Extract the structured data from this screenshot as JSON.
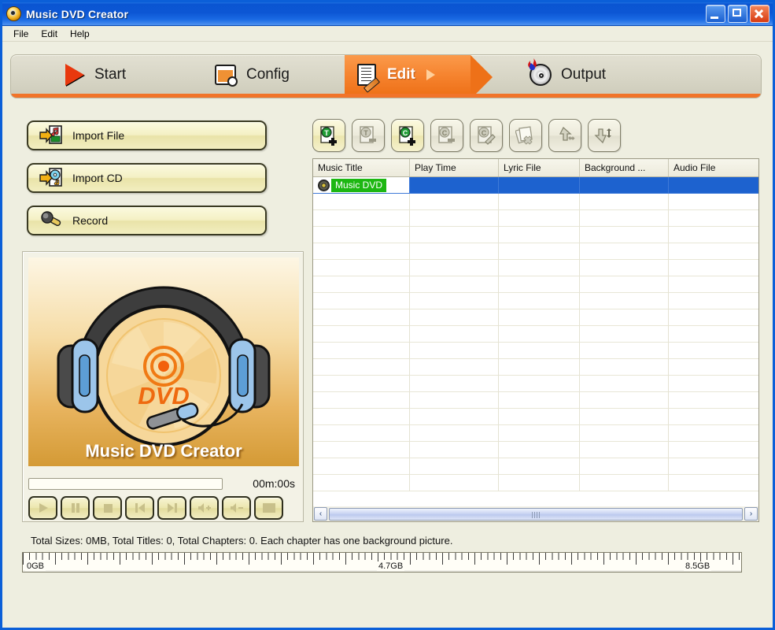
{
  "window": {
    "title": "Music DVD Creator",
    "icon": "disc-icon",
    "minimize_label": "Minimize",
    "maximize_label": "Maximize",
    "close_label": "Close"
  },
  "menubar": {
    "items": [
      {
        "label": "File"
      },
      {
        "label": "Edit"
      },
      {
        "label": "Help"
      }
    ]
  },
  "tabs": [
    {
      "label": "Start",
      "icon": "play-triangle-icon",
      "active": false
    },
    {
      "label": "Config",
      "icon": "window-gear-icon",
      "active": false
    },
    {
      "label": "Edit",
      "icon": "document-pencil-icon",
      "active": true
    },
    {
      "label": "Output",
      "icon": "burn-disc-icon",
      "active": false
    }
  ],
  "sidebar": {
    "buttons": [
      {
        "label": "Import File",
        "icon": "import-file-icon"
      },
      {
        "label": "Import CD",
        "icon": "import-cd-icon"
      },
      {
        "label": "Record",
        "icon": "microphone-icon"
      }
    ]
  },
  "preview": {
    "splash_caption": "Music DVD Creator",
    "timer": "00m:00s",
    "seek_value": 0,
    "controls": [
      {
        "name": "play",
        "label": "Play"
      },
      {
        "name": "pause",
        "label": "Pause"
      },
      {
        "name": "stop",
        "label": "Stop"
      },
      {
        "name": "previous",
        "label": "Previous"
      },
      {
        "name": "next",
        "label": "Next"
      },
      {
        "name": "volume-up",
        "label": "Volume Up"
      },
      {
        "name": "volume-down",
        "label": "Volume Down"
      },
      {
        "name": "fullscreen",
        "label": "Full Screen"
      }
    ]
  },
  "toolbar": {
    "buttons": [
      {
        "name": "add-title",
        "label": "Add Title",
        "enabled": true
      },
      {
        "name": "remove-title",
        "label": "Remove Title",
        "enabled": false
      },
      {
        "name": "add-chapter",
        "label": "Add Chapter",
        "enabled": true
      },
      {
        "name": "remove-chapter",
        "label": "Remove Chapter",
        "enabled": false
      },
      {
        "name": "edit-chapter",
        "label": "Edit Chapter",
        "enabled": false
      },
      {
        "name": "delete-all",
        "label": "Delete All",
        "enabled": false
      },
      {
        "name": "move-up",
        "label": "Move Up",
        "enabled": false
      },
      {
        "name": "move-down",
        "label": "Move Down",
        "enabled": false
      }
    ]
  },
  "table": {
    "columns": [
      "Music Title",
      "Play Time",
      "Lyric File",
      "Background ...",
      "Audio File"
    ],
    "rows": [
      {
        "selected": true,
        "editing": true,
        "icon": "disc-icon",
        "cells": [
          "Music DVD",
          "",
          "",
          "",
          ""
        ]
      }
    ],
    "empty_row_count": 18,
    "scrollbar": {
      "left_arrow": "‹",
      "right_arrow": "›"
    }
  },
  "status": {
    "text": "Total Sizes: 0MB, Total Titles: 0, Total Chapters: 0. Each chapter has one background picture."
  },
  "ruler": {
    "labels": [
      {
        "text": "0GB",
        "pos_pct": 0
      },
      {
        "text": "4.7GB",
        "pos_pct": 49.5
      },
      {
        "text": "8.5GB",
        "pos_pct": 92
      }
    ]
  },
  "colors": {
    "accent": "#f1742a",
    "titlebar": "#0c56d4",
    "selection": "#1d62cf",
    "edit_cell": "#1db712",
    "panel_bg": "#eeeee0"
  }
}
